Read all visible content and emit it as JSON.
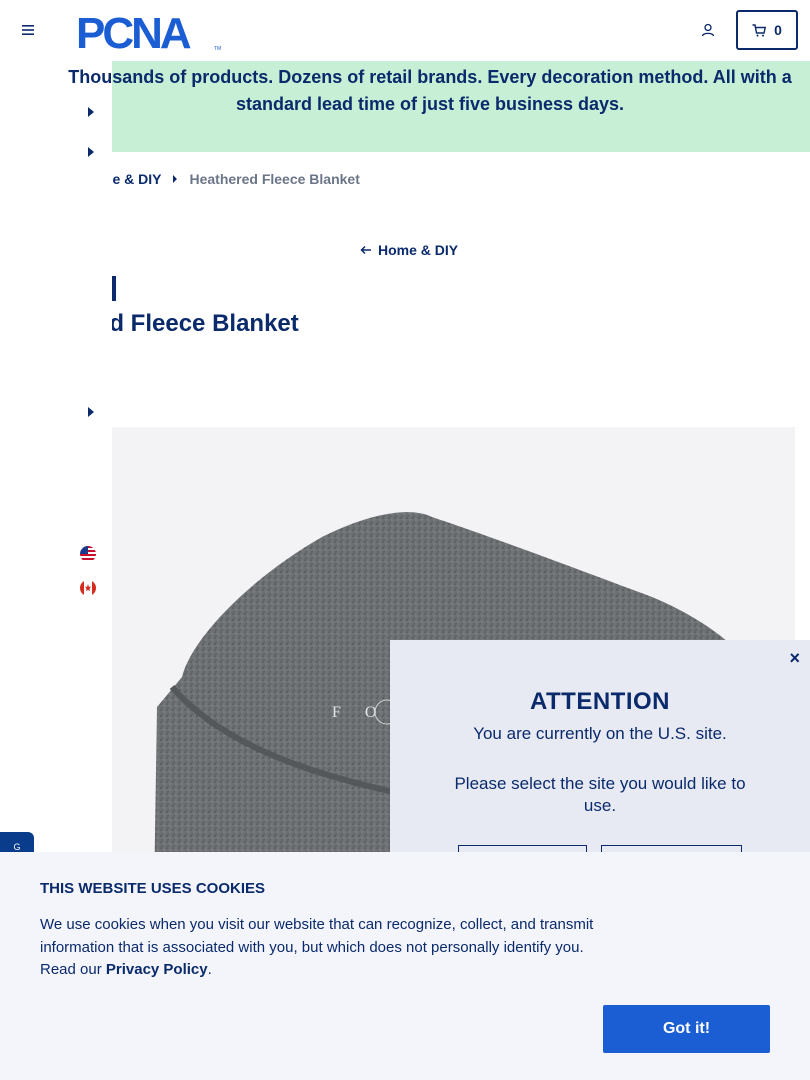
{
  "header": {
    "logo_text": "PCNA",
    "logo_tm": "TM",
    "cart_count": "0"
  },
  "banner": {
    "text": "Thousands of products. Dozens of retail brands. Every decoration method. All with a standard lead time of just five business days."
  },
  "breadcrumb": {
    "items": [
      "me & DIY",
      "Heathered Fleece Blanket"
    ]
  },
  "back_link": "Home & DIY",
  "product": {
    "category_badge": "ry",
    "title": "ed Fleece Blanket",
    "image_monogram": "F O S"
  },
  "attention": {
    "title": "ATTENTION",
    "line1": "You are currently on the U.S. site.",
    "line2": "Please select the site you would like to use.",
    "close": "×"
  },
  "side_tab": "G",
  "cookie": {
    "title": "THIS WEBSITE USES COOKIES",
    "body_text": "We use cookies when you visit our website that can recognize, collect, and transmit information that is associated with you, but which does not personally identify you. Read our ",
    "policy_link": "Privacy Policy",
    "period": ".",
    "button": "Got it!"
  },
  "colors": {
    "brand_navy": "#0a2a6b",
    "banner_green": "#c7efd5",
    "button_blue": "#1b5ed3",
    "cookie_bg": "#f4f5fb",
    "modal_bg": "#e8eaf3"
  }
}
